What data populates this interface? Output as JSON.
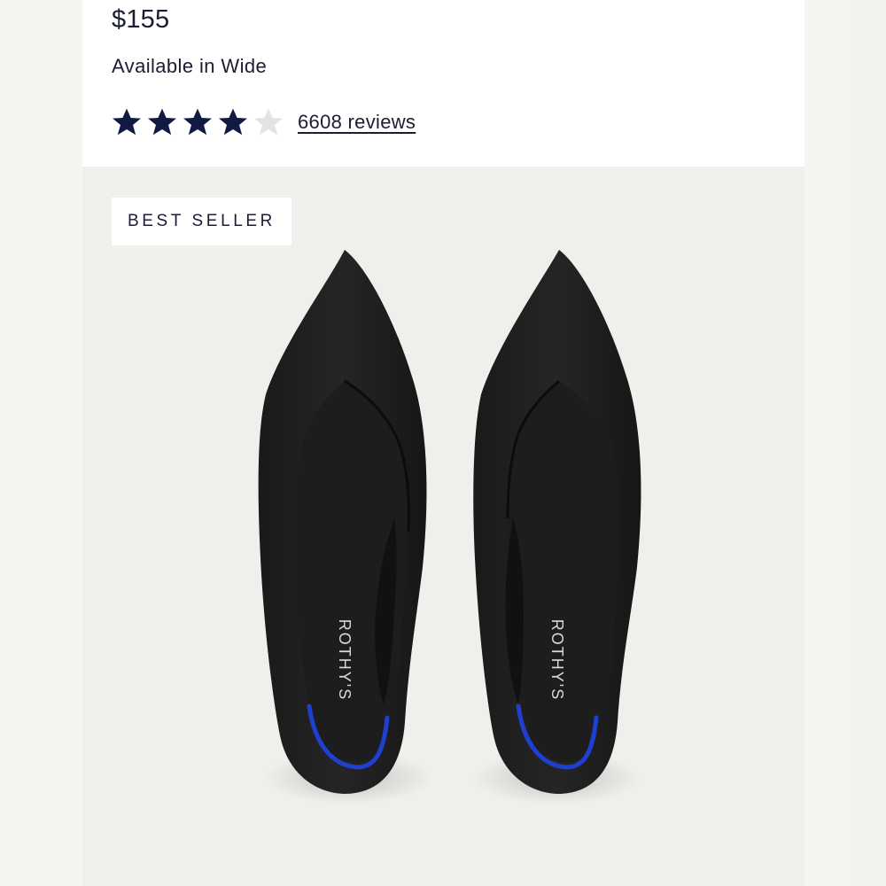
{
  "product": {
    "price": "$155",
    "availability": "Available in Wide",
    "rating": {
      "value": 4,
      "max": 5,
      "reviews_label": "6608 reviews"
    },
    "badge": "BEST SELLER",
    "image": {
      "subject": "black knit pointed-toe flats",
      "insole_brand": "ROTHY'S"
    }
  },
  "colors": {
    "star_filled": "#101a45",
    "star_empty": "#e3e3e3",
    "text": "#1b1d33",
    "heel_stripe": "#1f3fd1"
  }
}
